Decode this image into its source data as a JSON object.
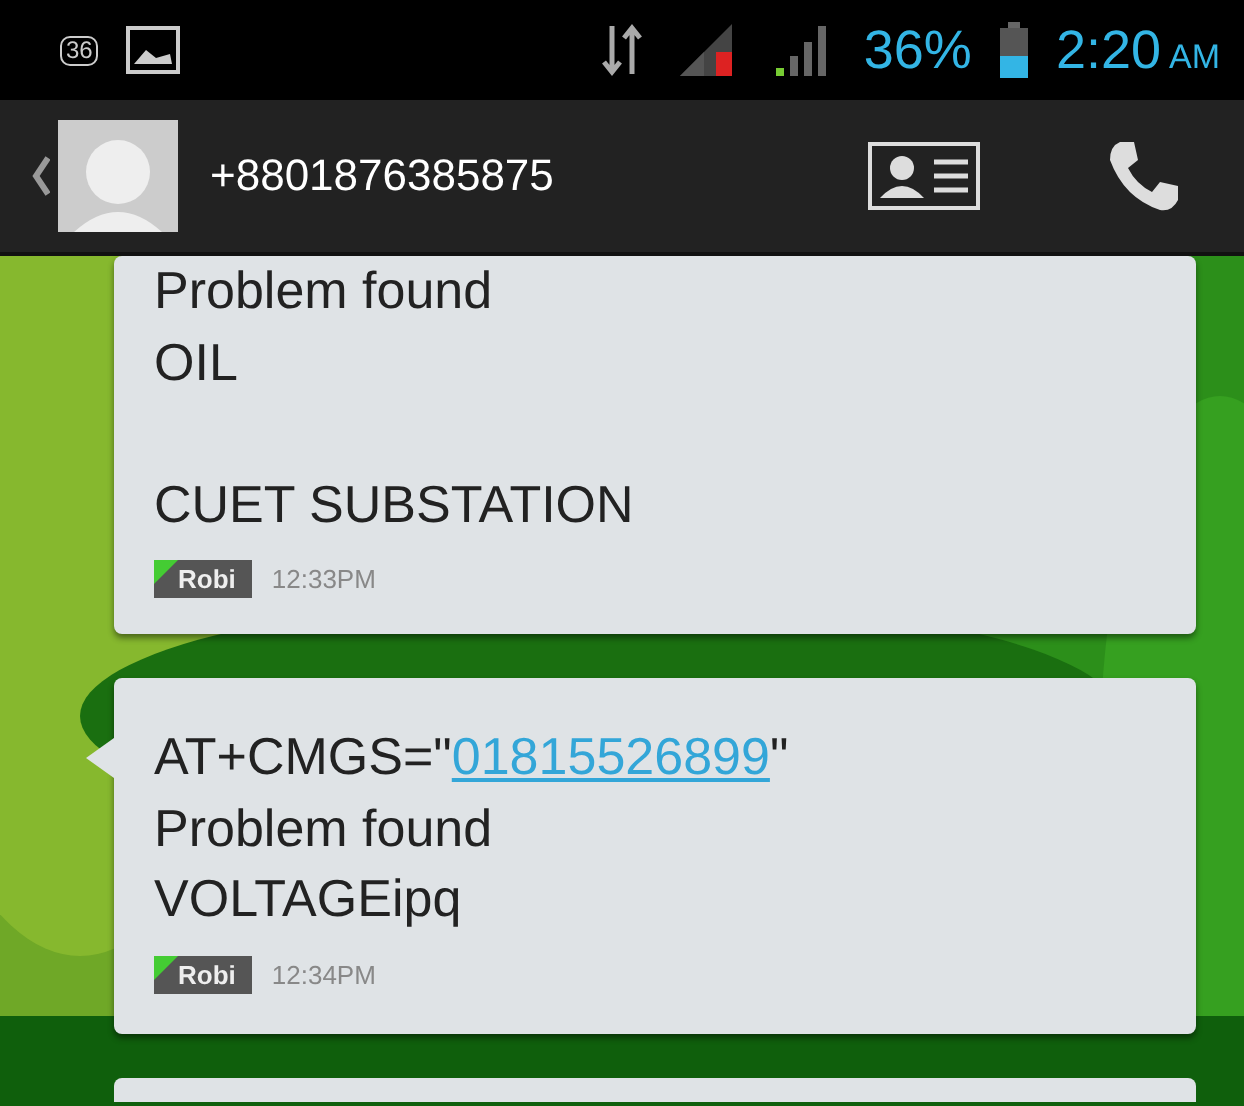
{
  "status_bar": {
    "notification_count": "36",
    "battery": "36%",
    "time": "2:20",
    "meridiem": "AM"
  },
  "header": {
    "contact": "+8801876385875"
  },
  "messages": [
    {
      "tail": false,
      "body": [
        {
          "kind": "plain",
          "text": "Problem found\nOIL\n\nCUET SUBSTATION"
        }
      ],
      "sim": "Robi",
      "time": "12:33PM"
    },
    {
      "tail": true,
      "body": [
        {
          "kind": "plain",
          "text": "AT+CMGS=\""
        },
        {
          "kind": "link",
          "text": "01815526899"
        },
        {
          "kind": "plain",
          "text": "\"\nProblem found\nVOLTAGEipq"
        }
      ],
      "sim": "Robi",
      "time": "12:34PM"
    }
  ]
}
